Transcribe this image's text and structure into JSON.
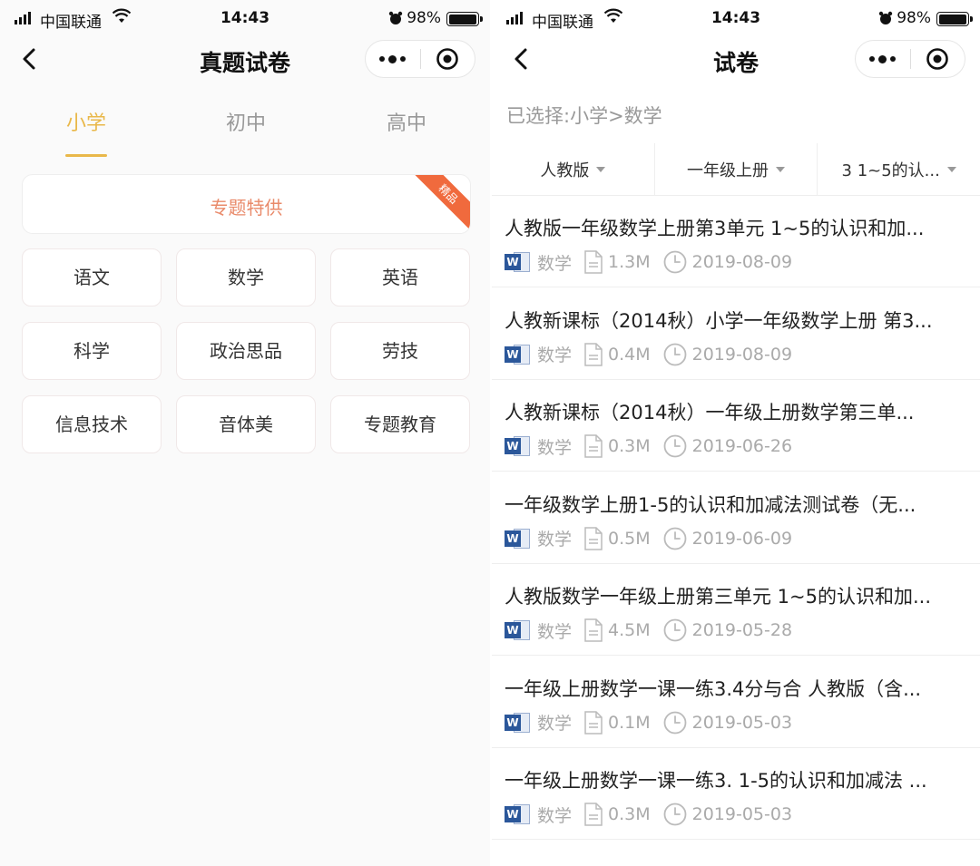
{
  "status": {
    "carrier": "中国联通",
    "time": "14:43",
    "battery": "98%",
    "battery_level": 0.98
  },
  "left": {
    "nav_title": "真题试卷",
    "tabs": [
      {
        "label": "小学",
        "active": true
      },
      {
        "label": "初中",
        "active": false
      },
      {
        "label": "高中",
        "active": false
      }
    ],
    "special": {
      "label": "专题特供",
      "ribbon": "精品"
    },
    "subjects": [
      "语文",
      "数学",
      "英语",
      "科学",
      "政治思品",
      "劳技",
      "信息技术",
      "音体美",
      "专题教育"
    ]
  },
  "right": {
    "nav_title": "试卷",
    "selected": "已选择:小学>数学",
    "filters": [
      "人教版",
      "一年级上册",
      "3 1~5的认..."
    ],
    "items": [
      {
        "title": "人教版一年级数学上册第3单元 1~5的认识和加...",
        "subject": "数学",
        "size": "1.3M",
        "date": "2019-08-09"
      },
      {
        "title": "人教新课标（2014秋）小学一年级数学上册 第3...",
        "subject": "数学",
        "size": "0.4M",
        "date": "2019-08-09"
      },
      {
        "title": "人教新课标（2014秋）一年级上册数学第三单...",
        "subject": "数学",
        "size": "0.3M",
        "date": "2019-06-26"
      },
      {
        "title": "一年级数学上册1-5的认识和加减法测试卷（无...",
        "subject": "数学",
        "size": "0.5M",
        "date": "2019-06-09"
      },
      {
        "title": "人教版数学一年级上册第三单元 1~5的认识和加...",
        "subject": "数学",
        "size": "4.5M",
        "date": "2019-05-28"
      },
      {
        "title": "一年级上册数学一课一练3.4分与合 人教版（含...",
        "subject": "数学",
        "size": "0.1M",
        "date": "2019-05-03"
      },
      {
        "title": "一年级上册数学一课一练3. 1-5的认识和加减法 ...",
        "subject": "数学",
        "size": "0.3M",
        "date": "2019-05-03"
      }
    ]
  },
  "colors": {
    "accent": "#e9b84a",
    "special_text": "#e98a6a",
    "ribbon": "#f06a3d",
    "word_blue": "#2b579a"
  },
  "icons": [
    "signal-icon",
    "wifi-icon",
    "alarm-icon",
    "battery-icon",
    "back-icon",
    "more-icon",
    "target-icon",
    "caret-down-icon",
    "word-doc-icon",
    "file-icon",
    "clock-icon"
  ]
}
